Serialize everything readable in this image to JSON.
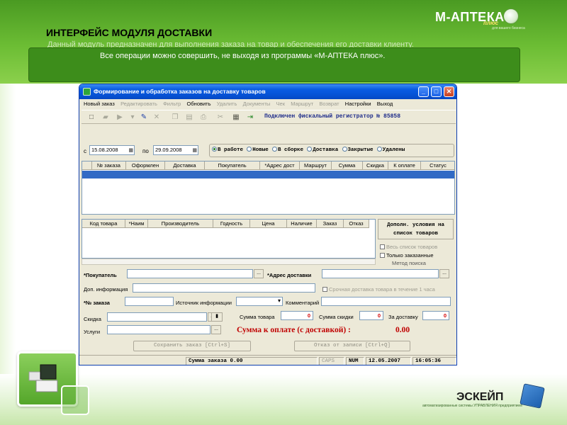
{
  "slide": {
    "title": "ИНТЕРФЕЙС МОДУЛЯ ДОСТАВКИ",
    "subtitle": "Данный модуль предназначен для выполнения заказа на товар и обеспечения его доставки клиенту.",
    "info": "Все операции можно совершить, не выходя из программы «М-АПТЕКА плюс».",
    "brand": {
      "name": "М-АПТЕКА",
      "plus": "плюс",
      "tagline": "для вашего бизнеса"
    },
    "company": {
      "name": "ЭСКЕЙП",
      "tagline": "автоматизированные системы УПРАВЛЕНИЯ предприятием"
    }
  },
  "window": {
    "title": "Формирование и обработка заказов на доставку товаров",
    "controls": {
      "minimize": "_",
      "maximize": "□",
      "close": "✕"
    },
    "menu": [
      {
        "label": "Новый заказ",
        "enabled": true
      },
      {
        "label": "Редактировать",
        "enabled": false
      },
      {
        "label": "Фильтр",
        "enabled": false
      },
      {
        "label": "Обновить",
        "enabled": true
      },
      {
        "label": "Удалить",
        "enabled": false
      },
      {
        "label": "Документы",
        "enabled": false
      },
      {
        "label": "Чек",
        "enabled": false
      },
      {
        "label": "Маршрут",
        "enabled": false
      },
      {
        "label": "Возврат",
        "enabled": false
      },
      {
        "label": "Настройки",
        "enabled": true
      },
      {
        "label": "Выход",
        "enabled": true
      }
    ],
    "fiscal_status": "Подключен фискальный регистратор № 85858",
    "filter": {
      "from_label": "с",
      "from_date": "15.08.2008",
      "to_label": "по",
      "to_date": "29.09.2008",
      "statuses": [
        {
          "label": "В работе",
          "selected": true
        },
        {
          "label": "Новые",
          "selected": false
        },
        {
          "label": "В сборке",
          "selected": false
        },
        {
          "label": "Доставка",
          "selected": false
        },
        {
          "label": "Закрытые",
          "selected": false
        },
        {
          "label": "Удалены",
          "selected": false
        }
      ]
    },
    "orders_table": {
      "columns": [
        "№ заказа",
        "Оформлен",
        "Доставка",
        "Покупатель",
        "*Адрес дост",
        "Маршрут",
        "Сумма",
        "Скидка",
        "К оплате",
        "Статус"
      ]
    },
    "items_table": {
      "columns": [
        "Код товара",
        "*Наим",
        "Производитель",
        "Годность",
        "Цена",
        "Наличие",
        "Заказ",
        "Отказ"
      ]
    },
    "side_panel": {
      "button": "Дополн. условия на список товаров",
      "all_items": "Весь список товаров",
      "ordered_only": "Только заказанные",
      "search_method": "Метод поиска"
    },
    "form": {
      "buyer_label": "*Покупатель",
      "address_label": "*Адрес доставки",
      "extra_info_label": "Доп. информация",
      "urgent_label": "Срочная доставка товара в течение 1 часа",
      "order_no_label": "*№ заказа",
      "source_label": "Источник информации",
      "comment_label": "Комментарий",
      "discount_label": "Скидка",
      "services_label": "Услуги",
      "goods_sum_label": "Сумма товара",
      "goods_sum": "0",
      "discount_sum_label": "Сумма скидки",
      "discount_sum": "0",
      "delivery_label": "За доставку",
      "delivery_sum": "0",
      "ellipsis": "..."
    },
    "total": {
      "label": "Сумма к оплате (с доставкой) :",
      "value": "0.00"
    },
    "actions": {
      "save": "Сохранить заказ [Ctrl+S]",
      "cancel": "Отказ от записи [Ctrl+Q]"
    },
    "statusbar": {
      "sum": "Сумма заказа 0.00",
      "caps": "CAPS",
      "num": "NUM",
      "date": "12.05.2007",
      "time": "16:05:36"
    }
  },
  "colors": {
    "green_band": "#6cbd34",
    "info_box": "#3d8d1b",
    "xp_title": "#0653d6",
    "selection": "#316ac5",
    "total_red": "#c00000"
  }
}
